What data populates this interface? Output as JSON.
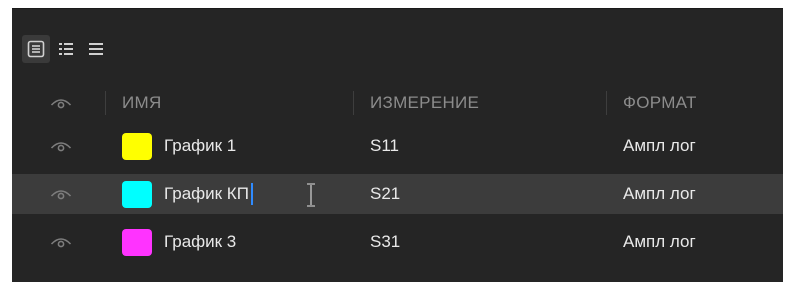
{
  "toolbar": {
    "buttons": [
      {
        "icon": "detail-view-icon",
        "active": true
      },
      {
        "icon": "grid-view-icon",
        "active": false
      },
      {
        "icon": "list-view-icon",
        "active": false
      }
    ]
  },
  "table": {
    "columns": {
      "visibility": "eye-icon",
      "name": "ИМЯ",
      "measurement": "ИЗМЕРЕНИЕ",
      "format": "ФОРМАТ"
    },
    "rows": [
      {
        "name": "График 1",
        "measurement": "S11",
        "format": "Ампл лог",
        "color": "#ffff00",
        "selected": false
      },
      {
        "name": "График КП",
        "measurement": "S21",
        "format": "Ампл лог",
        "color": "#00ffff",
        "selected": true
      },
      {
        "name": "График 3",
        "measurement": "S31",
        "format": "Ампл лог",
        "color": "#ff33ff",
        "selected": false
      }
    ]
  },
  "colors": {
    "panel_bg": "#252525",
    "selected_row_bg": "#3c3c3c",
    "header_text": "#8c8c8c",
    "cell_text": "#e9e9e9",
    "caret": "#2f8bff"
  }
}
